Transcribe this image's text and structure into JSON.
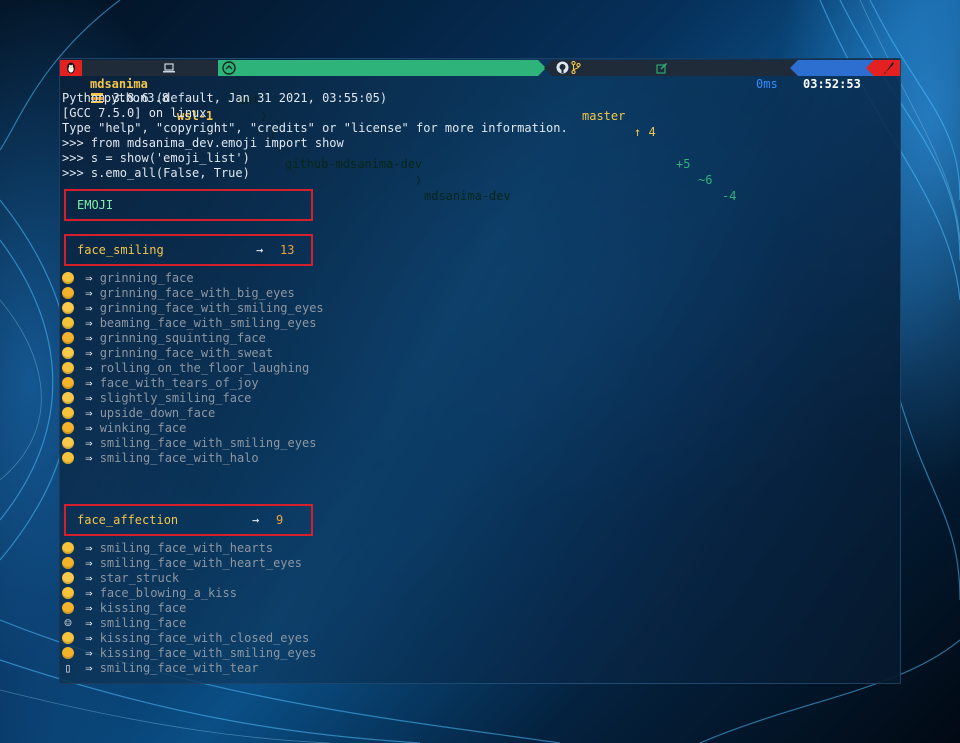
{
  "colors": {
    "prompt_red": "#e52020",
    "prompt_green": "#2eb37a",
    "prompt_dark": "#1f2b38",
    "prompt_time_blue": "#2d6fd1",
    "box_border": "#d5202c",
    "emoji_name": "#8d96a0",
    "category_yellow": "#f3c54a",
    "count_orange": "#f0a23c",
    "emoji_header_green": "#7ef0b0"
  },
  "prompt": {
    "os_icon": "linux-penguin-icon",
    "user": "mdsanima",
    "host_icon": "laptop-icon",
    "host": "wsl-1",
    "dir_icon": "folder-icon",
    "path": [
      "mnt",
      "j",
      "github-mdsanima-dev",
      "mdsanima-dev"
    ],
    "git_icon": "github-icon",
    "branch_icon": "git-branch-icon",
    "branch": "master",
    "ahead": "↑ 4",
    "edit_icon": "pencil-square-icon",
    "added": "+5",
    "modified": "~6",
    "deleted": "-4",
    "duration": "0ms",
    "time": "03:52:53",
    "end_icon": "rocket-icon"
  },
  "terminal": {
    "command_icon": "stack-icon",
    "lines": [
      "python3.8",
      "Python 3.8.6 (default, Jan 31 2021, 03:55:05)",
      "[GCC 7.5.0] on linux",
      "Type \"help\", \"copyright\", \"credits\" or \"license\" for more information.",
      ">>> from mdsanima_dev.emoji import show",
      ">>> s = show('emoji_list')",
      ">>> s.emo_all(False, True)"
    ]
  },
  "emoji_header": "EMOJI",
  "groups": [
    {
      "title": "face_smiling",
      "arrow": "→",
      "count": "13",
      "items": [
        "grinning_face",
        "grinning_face_with_big_eyes",
        "grinning_face_with_smiling_eyes",
        "beaming_face_with_smiling_eyes",
        "grinning_squinting_face",
        "grinning_face_with_sweat",
        "rolling_on_the_floor_laughing",
        "face_with_tears_of_joy",
        "slightly_smiling_face",
        "upside_down_face",
        "winking_face",
        "smiling_face_with_smiling_eyes",
        "smiling_face_with_halo"
      ]
    },
    {
      "title": "face_affection",
      "arrow": "→",
      "count": "9",
      "items": [
        "smiling_face_with_hearts",
        "smiling_face_with_heart_eyes",
        "star_struck",
        "face_blowing_a_kiss",
        "kissing_face",
        "smiling_face",
        "kissing_face_with_closed_eyes",
        "kissing_face_with_smiling_eyes",
        "smiling_face_with_tear"
      ]
    }
  ],
  "item_arrow": "⇒",
  "plain_glyphs": {
    "smiling_face": "☺",
    "smiling_face_with_tear": "▯"
  }
}
